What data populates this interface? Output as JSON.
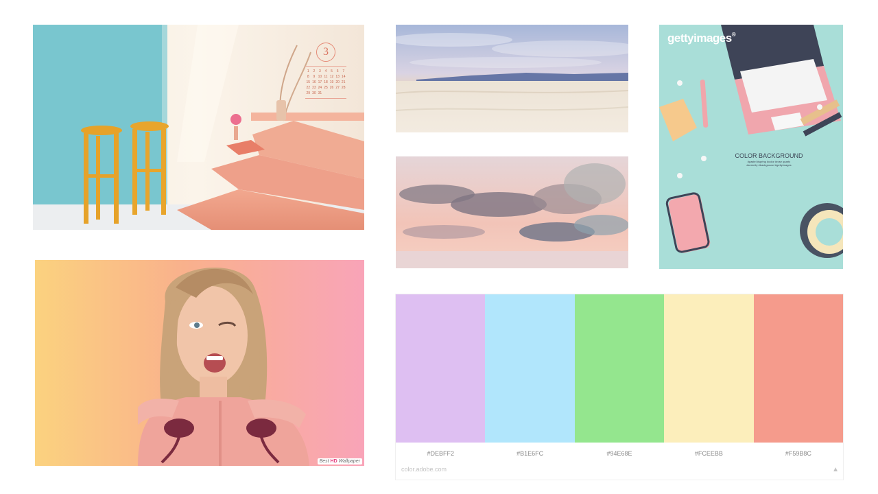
{
  "images": {
    "room": {
      "calendar_month": "3",
      "calendar_days": [
        "1",
        "2",
        "3",
        "4",
        "5",
        "6",
        "7",
        "8",
        "9",
        "10",
        "11",
        "12",
        "13",
        "14",
        "15",
        "16",
        "17",
        "18",
        "19",
        "20",
        "21",
        "22",
        "23",
        "24",
        "25",
        "26",
        "27",
        "28",
        "29",
        "30",
        "31"
      ]
    },
    "getty": {
      "brand": "gettyimages",
      "trademark": "®",
      "caption_title": "COLOR BACKGROUND",
      "caption_tags_1": "#pastel #spring #color #rose quartz",
      "caption_tags_2": "#serenity #background #gettyimages"
    },
    "portrait": {
      "watermark_prefix": "Best",
      "watermark_badge": "HD",
      "watermark_suffix": "Wallpaper"
    }
  },
  "palette": {
    "swatches": [
      {
        "hex": "#DEBFF2",
        "label": "#DEBFF2"
      },
      {
        "hex": "#B1E6FC",
        "label": "#B1E6FC"
      },
      {
        "hex": "#94E68E",
        "label": "#94E68E"
      },
      {
        "hex": "#FCEEBB",
        "label": "#FCEEBB"
      },
      {
        "hex": "#F59B8C",
        "label": "#F59B8C"
      }
    ],
    "source": "color.adobe.com",
    "icon": "adobe-logo-icon"
  }
}
